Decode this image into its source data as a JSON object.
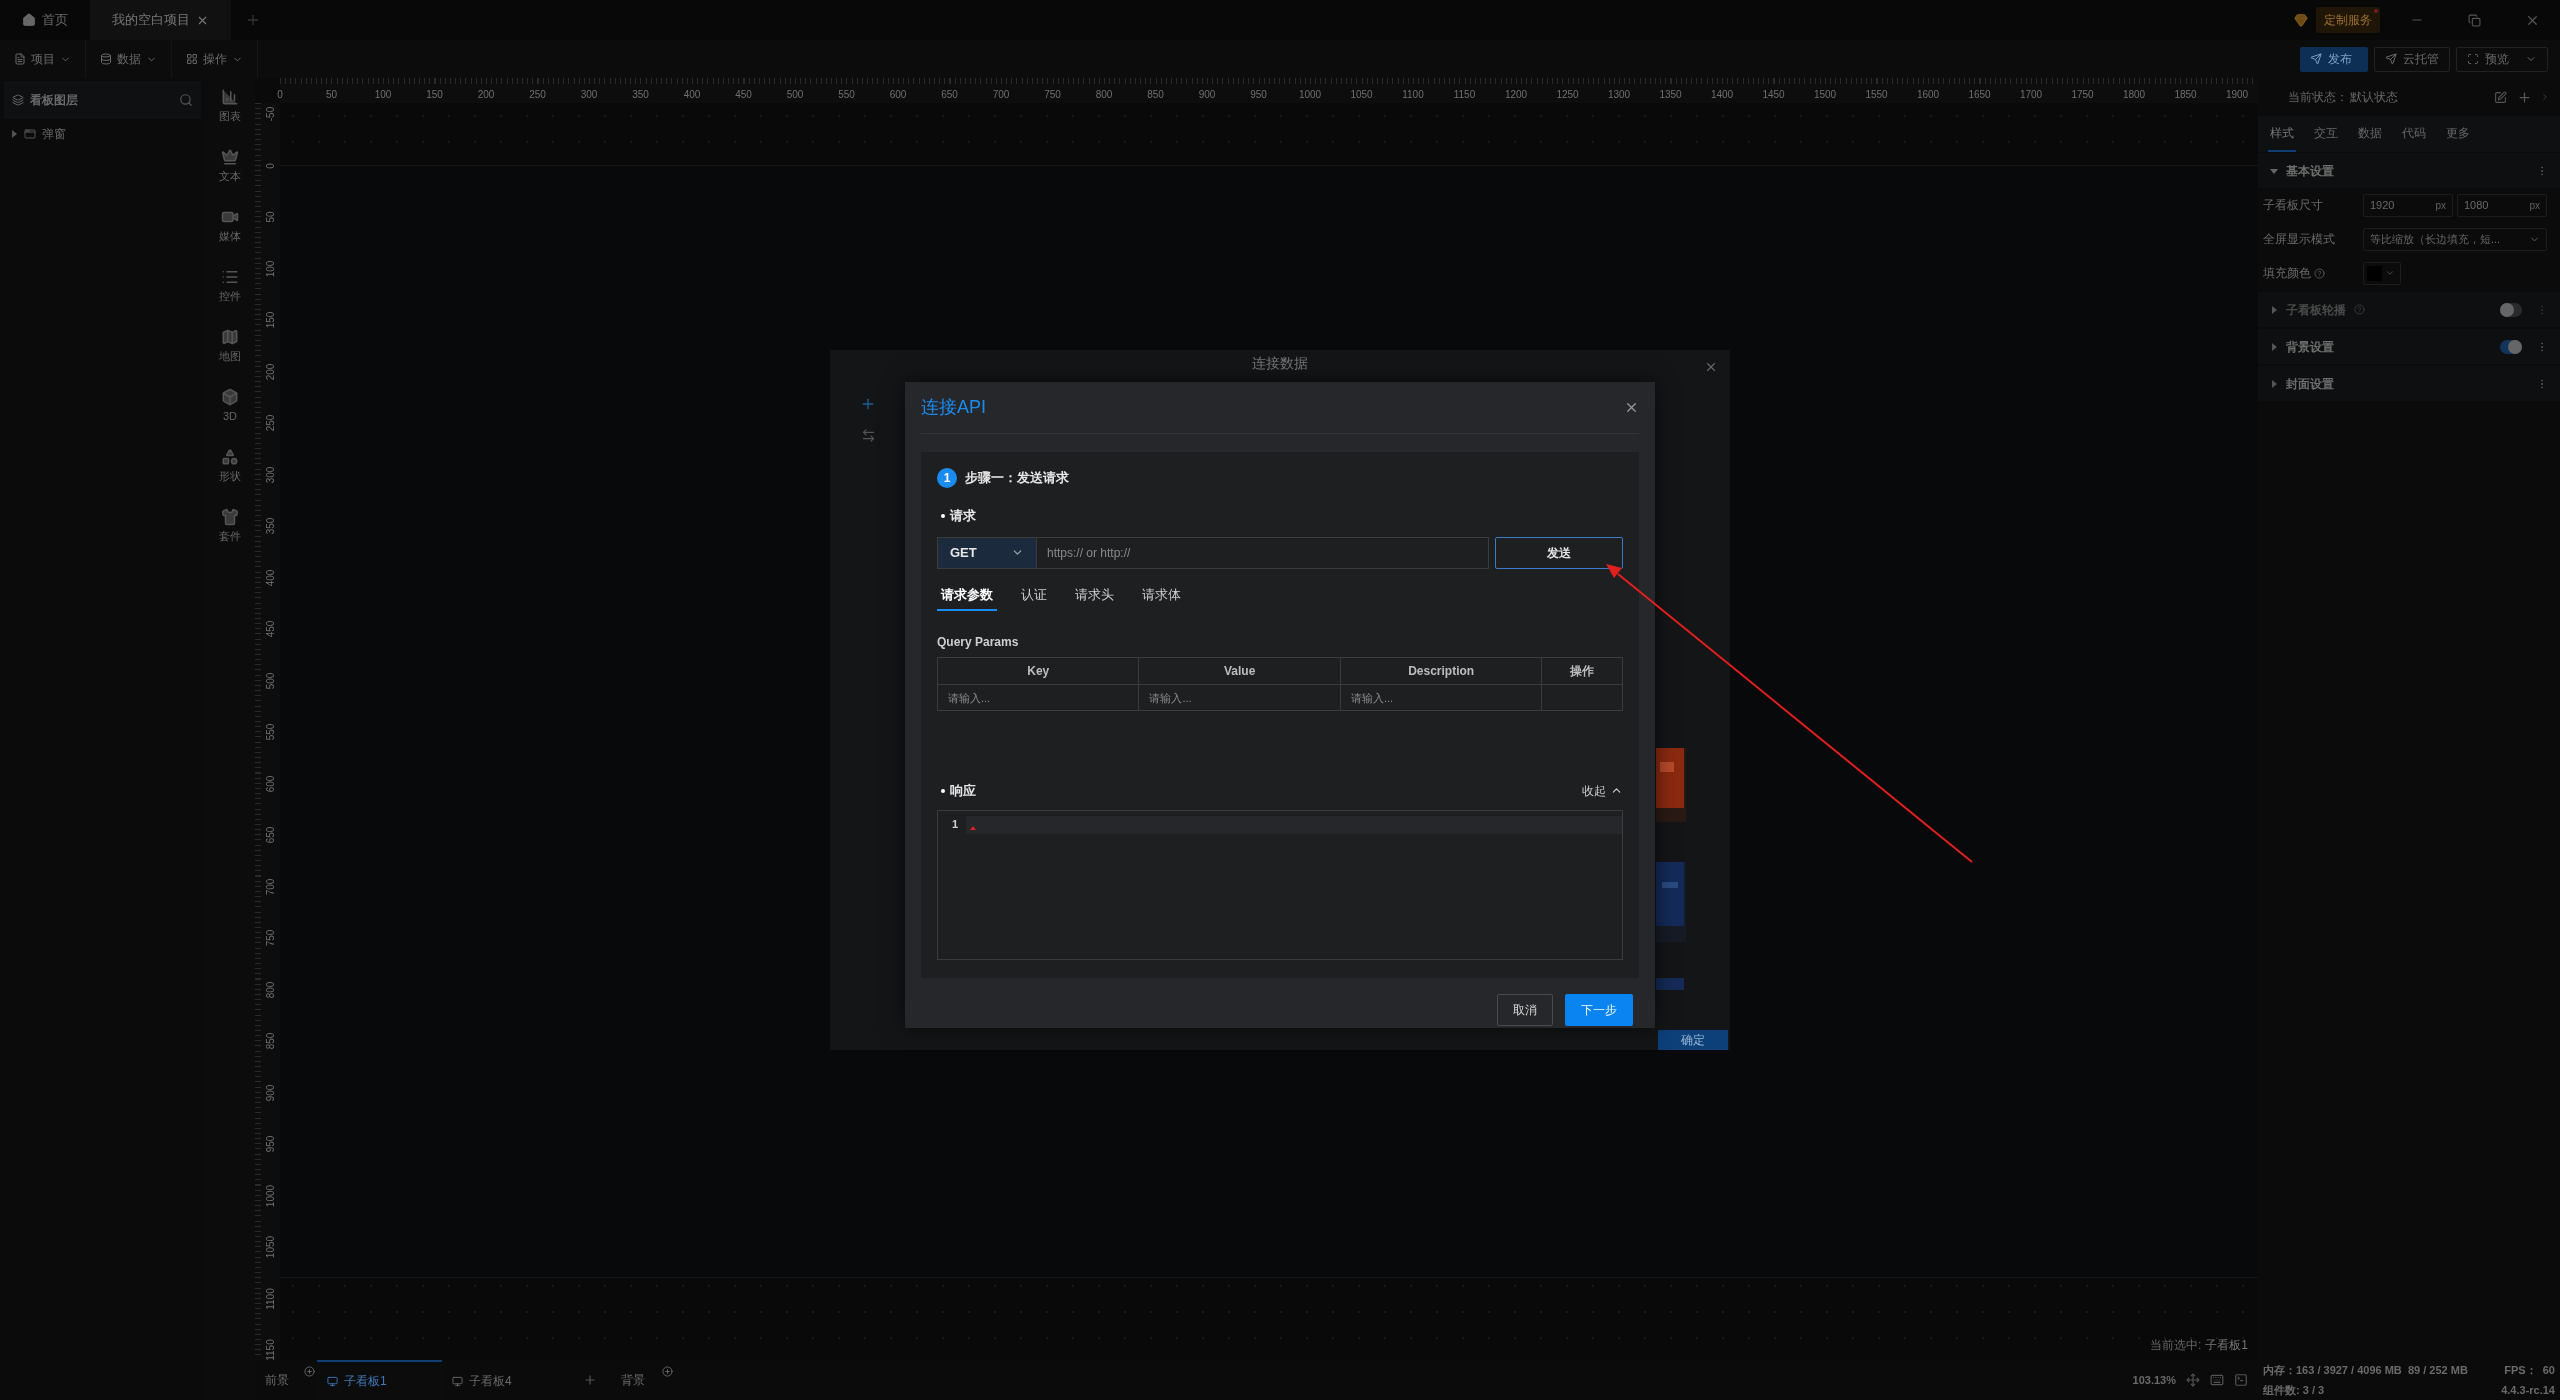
{
  "top_tabs": [
    {
      "label": "首页",
      "kind": "home",
      "selected": false
    },
    {
      "label": "我的空白项目",
      "kind": "project",
      "selected": true
    }
  ],
  "service_badge": "定制服务",
  "menus": [
    {
      "label": "项目",
      "kind": "file"
    },
    {
      "label": "数据",
      "kind": "database"
    },
    {
      "label": "操作",
      "kind": "grid"
    }
  ],
  "actions": [
    {
      "label": "发布",
      "kind": "primary"
    },
    {
      "label": "云托管",
      "kind": "default"
    },
    {
      "label": "预览",
      "kind": "dropdown"
    }
  ],
  "layers_panel": {
    "title": "看板图层",
    "items": [
      {
        "label": "弹窗",
        "expanded": false
      }
    ]
  },
  "component_bar": [
    {
      "label": "图表",
      "kind": "chart"
    },
    {
      "label": "文本",
      "kind": "text"
    },
    {
      "label": "媒体",
      "kind": "media"
    },
    {
      "label": "控件",
      "kind": "control"
    },
    {
      "label": "地图",
      "kind": "map"
    },
    {
      "label": "3D",
      "kind": "cube"
    },
    {
      "label": "形状",
      "kind": "shape"
    },
    {
      "label": "套件",
      "kind": "kit"
    }
  ],
  "ruler": {
    "x_labels": [
      "0",
      "50",
      "100",
      "150",
      "200",
      "250",
      "300",
      "350",
      "400",
      "450",
      "500",
      "550",
      "600",
      "650",
      "700",
      "750",
      "800",
      "850",
      "900",
      "950",
      "1000",
      "1050",
      "1100",
      "1150",
      "1200",
      "1250",
      "1300",
      "1350",
      "1400",
      "1450",
      "1500",
      "1550",
      "1600",
      "1650",
      "1700",
      "1750",
      "1800",
      "1850",
      "1900"
    ],
    "y_labels": [
      "-50",
      "0",
      "50",
      "100",
      "150",
      "200",
      "250",
      "300",
      "350",
      "400",
      "450",
      "500",
      "550",
      "600",
      "650",
      "700",
      "750",
      "800",
      "850",
      "900",
      "950",
      "1000",
      "1050",
      "1100",
      "1150"
    ]
  },
  "bottom_tabs": {
    "foreground": "前景",
    "boards": [
      {
        "label": "子看板1",
        "selected": true
      },
      {
        "label": "子看板4",
        "selected": false
      }
    ],
    "background": "背景"
  },
  "selection_status": {
    "label": "当前选中:",
    "value": "子看板1"
  },
  "right_panel": {
    "state_label": "当前状态：",
    "state_value": "默认状态",
    "tabs": [
      {
        "label": "样式",
        "selected": true
      },
      {
        "label": "交互",
        "selected": false
      },
      {
        "label": "数据",
        "selected": false
      },
      {
        "label": "代码",
        "selected": false
      },
      {
        "label": "更多",
        "selected": false
      }
    ],
    "sections": [
      {
        "title": "基本设置",
        "expanded": true,
        "disabled": false,
        "fields": [
          {
            "kind": "size",
            "label": "子看板尺寸",
            "values": [
              "1920",
              "1080"
            ],
            "units": [
              "px",
              "px"
            ]
          },
          {
            "kind": "select",
            "label": "全屏显示模式",
            "value": "等比缩放（长边填充，短..."
          },
          {
            "kind": "color",
            "label": "填充颜色",
            "help": true,
            "color": "#000000"
          }
        ]
      },
      {
        "title": "子看板轮播",
        "expanded": false,
        "disabled": true,
        "help": true,
        "toggle": false
      },
      {
        "title": "背景设置",
        "expanded": false,
        "disabled": false,
        "toggle": true
      },
      {
        "title": "封面设置",
        "expanded": false,
        "disabled": false
      }
    ]
  },
  "status_bar": {
    "zoom": "103.13%",
    "memory": "内存：163 / 3927 / 4096 MB  89 / 252 MB",
    "fps": "FPS：  60",
    "components": "组件数: 3 / 3",
    "version": "4.4.3-rc.14"
  },
  "back_dialog": {
    "title": "连接数据",
    "confirm": "确定"
  },
  "api_dialog": {
    "title": "连接API",
    "step_number": "1",
    "step_title": "步骤一：发送请求",
    "request_label": "请求",
    "method": "GET",
    "url_placeholder": "https:// or http://",
    "send": "发送",
    "tabs": [
      {
        "label": "请求参数",
        "selected": true
      },
      {
        "label": "认证",
        "selected": false
      },
      {
        "label": "请求头",
        "selected": false
      },
      {
        "label": "请求体",
        "selected": false
      }
    ],
    "params_title": "Query Params",
    "columns": [
      "Key",
      "Value",
      "Description",
      "操作"
    ],
    "row_placeholders": [
      "请输入...",
      "请输入...",
      "请输入..."
    ],
    "response_label": "响应",
    "collapse": "收起",
    "line_numbers": [
      "1"
    ],
    "buttons": [
      {
        "label": "取消",
        "kind": "default"
      },
      {
        "label": "下一步",
        "kind": "primary"
      }
    ]
  }
}
